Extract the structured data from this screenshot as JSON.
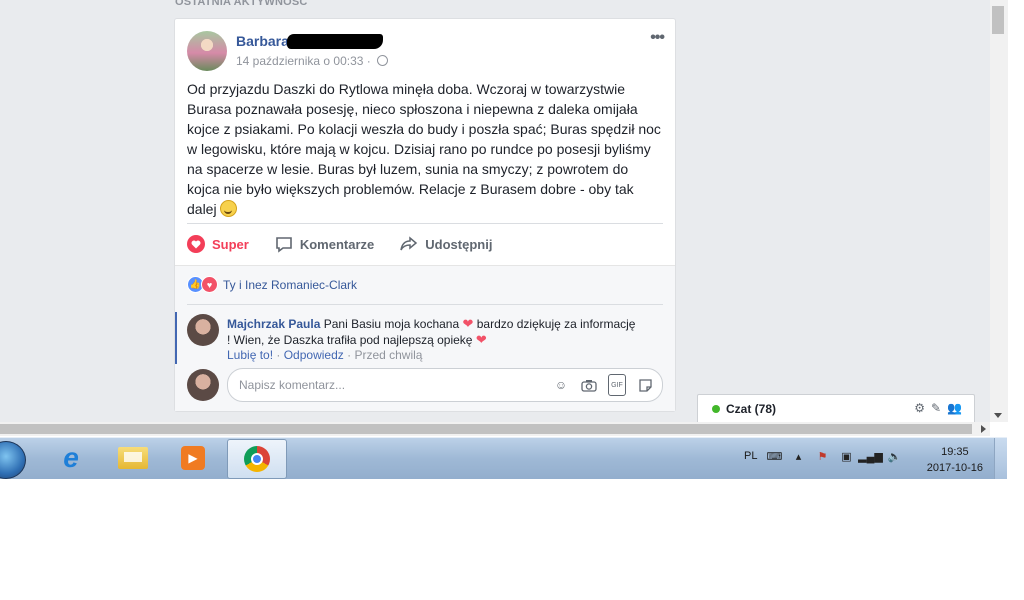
{
  "section_title": "OSTATNIA AKTYWNOŚĆ",
  "post": {
    "author": "Barbara",
    "date": "14 października o 00:33 ·",
    "more_label": "•••",
    "text": "Od przyjazdu Daszki do Rytlowa minęła doba. Wczoraj w towarzystwie\nBurasa poznawała posesję, nieco spłoszona i niepewna z daleka omijała\nkojce z psiakami. Po kolacji weszła do budy i poszła spać; Buras spędził noc\nw legowisku, które mają w kojcu. Dzisiaj rano po rundce po posesji byliśmy\nna spacerze w lesie. Buras był luzem, sunia na smyczy; z powrotem do\nkojca nie było większych problemów. Relacje z Burasem dobre - oby tak\ndalej",
    "actions": {
      "react": "Super",
      "comment": "Komentarze",
      "share": "Udostępnij"
    },
    "reactions": "Ty i Inez Romaniec-Clark"
  },
  "comment": {
    "author": "Majchrzak Paula",
    "text_1": "Pani Basiu moja kochana",
    "text_2": "bardzo dziękuję za informację",
    "text_3": "! Wien, że Daszka trafiła pod najlepszą opiekę",
    "like": "Lubię to!",
    "reply": "Odpowiedz",
    "time": "Przed chwilą"
  },
  "composer": {
    "placeholder": "Napisz komentarz...",
    "gif": "GIF"
  },
  "chat": {
    "label": "Czat (78)"
  },
  "taskbar": {
    "lang": "PL",
    "time": "19:35",
    "date": "2017-10-16"
  },
  "colors": {
    "link": "#365899",
    "super": "#f33e58",
    "online": "#42b72a"
  },
  "icons": [
    "globe-icon",
    "smiley-icon",
    "heart-icon",
    "like-icon",
    "comment-icon",
    "share-icon",
    "camera-icon",
    "gif-icon",
    "sticker-icon",
    "gear-icon",
    "edit-icon",
    "group-icon",
    "chrome-icon",
    "ie-icon",
    "folder-icon",
    "media-player-icon"
  ]
}
